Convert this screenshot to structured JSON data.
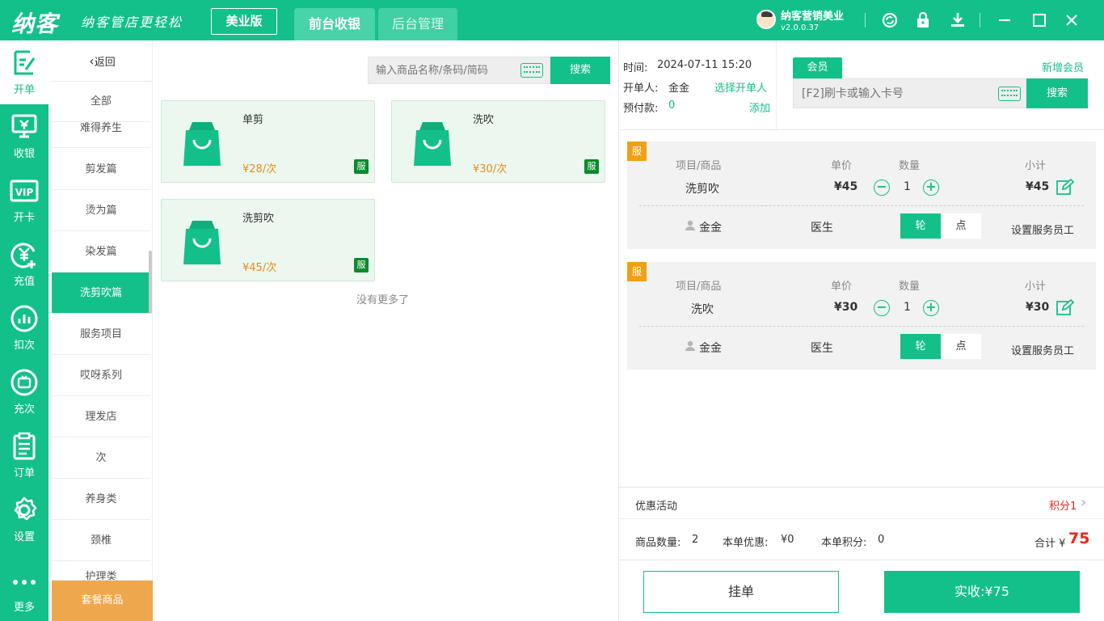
{
  "header": {
    "logo": "纳客",
    "slogan": "纳客管店更轻松",
    "edition": "美业版",
    "tabs": [
      "前台收银",
      "后台管理"
    ],
    "store_name": "纳客营销美业",
    "version": "v2.0.0.37",
    "icons": [
      "refresh-icon",
      "lock-icon",
      "download-icon",
      "minimize-icon",
      "maximize-icon",
      "close-icon"
    ]
  },
  "nav": [
    {
      "label": "开单",
      "icon": "order-edit-icon"
    },
    {
      "label": "收银",
      "icon": "cashier-icon"
    },
    {
      "label": "开卡",
      "icon": "vip-icon"
    },
    {
      "label": "充值",
      "icon": "recharge-icon"
    },
    {
      "label": "扣次",
      "icon": "deduct-icon"
    },
    {
      "label": "充次",
      "icon": "recharge-times-icon"
    },
    {
      "label": "订单",
      "icon": "order-list-icon"
    },
    {
      "label": "设置",
      "icon": "settings-icon"
    },
    {
      "label": "更多",
      "icon": "more-icon"
    }
  ],
  "categories": {
    "back": "返回",
    "items": [
      "全部",
      "难得养生",
      "剪发篇",
      "烫为篇",
      "染发篇",
      "洗剪吹篇",
      "服务项目",
      "哎呀系列",
      "理发店",
      "次",
      "养身类",
      "颈椎",
      "护理类"
    ],
    "active": "洗剪吹篇",
    "combo": "套餐商品"
  },
  "search": {
    "placeholder": "输入商品名称/条码/简码",
    "button": "搜索"
  },
  "products": [
    {
      "name": "单剪",
      "price": "¥28/次",
      "tag": "服"
    },
    {
      "name": "洗吹",
      "price": "¥30/次",
      "tag": "服"
    },
    {
      "name": "洗剪吹",
      "price": "¥45/次",
      "tag": "服"
    }
  ],
  "no_more": "没有更多了",
  "order_info": {
    "time_label": "时间:",
    "time": "2024-07-11 15:20",
    "opener_label": "开单人:",
    "opener": "金金",
    "choose_opener": "选择开单人",
    "prepay_label": "预付款:",
    "prepay": "0",
    "add": "添加"
  },
  "member": {
    "tab": "会员",
    "new_member": "新增会员",
    "placeholder": "[F2]刷卡或输入卡号",
    "button": "搜索"
  },
  "order_headers": {
    "item": "项目/商品",
    "price": "单价",
    "qty": "数量",
    "subtotal": "小计"
  },
  "order_items": [
    {
      "tag": "服",
      "name": "洗剪吹",
      "price": "¥45",
      "qty": "1",
      "subtotal": "¥45",
      "staff": "金金",
      "role": "医生",
      "mode_a": "轮",
      "mode_b": "点",
      "set_staff": "设置服务员工"
    },
    {
      "tag": "服",
      "name": "洗吹",
      "price": "¥30",
      "qty": "1",
      "subtotal": "¥30",
      "staff": "金金",
      "role": "医生",
      "mode_a": "轮",
      "mode_b": "点",
      "set_staff": "设置服务员工"
    }
  ],
  "promo": {
    "label": "优惠活动",
    "points": "积分1"
  },
  "summary": {
    "count_label": "商品数量:",
    "count": "2",
    "discount_label": "本单优惠:",
    "discount": "¥0",
    "points_label": "本单积分:",
    "points": "0",
    "total_label": "合计 ¥",
    "total": "75"
  },
  "footer": {
    "hold": "挂单",
    "pay": "实收:¥75"
  },
  "colors": {
    "primary": "#13c08a",
    "orange": "#efa74d",
    "price": "#e98c1a",
    "tag": "#f0a015",
    "total": "#e8261e"
  }
}
